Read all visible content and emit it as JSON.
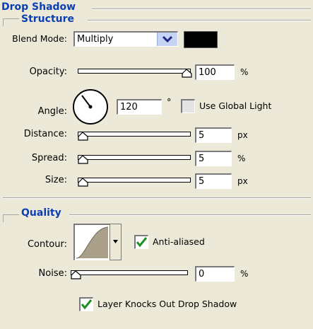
{
  "panel": {
    "title": "Drop Shadow"
  },
  "structure": {
    "title": "Structure",
    "blend_mode": {
      "label": "Blend Mode:",
      "value": "Multiply",
      "color": "#000000"
    },
    "opacity": {
      "label": "Opacity:",
      "value": "100",
      "unit": "%",
      "level": 1.0
    },
    "angle": {
      "label": "Angle:",
      "value": "120",
      "unit": "°",
      "use_global_light_label": "Use Global Light",
      "use_global_light_checked": false
    },
    "distance": {
      "label": "Distance:",
      "value": "5",
      "unit": "px",
      "level": 0.0
    },
    "spread": {
      "label": "Spread:",
      "value": "5",
      "unit": "%",
      "level": 0.0
    },
    "size": {
      "label": "Size:",
      "value": "5",
      "unit": "px",
      "level": 0.0
    }
  },
  "quality": {
    "title": "Quality",
    "contour": {
      "label": "Contour:"
    },
    "anti_aliased": {
      "label": "Anti-aliased",
      "checked": true
    },
    "noise": {
      "label": "Noise:",
      "value": "0",
      "unit": "%",
      "level": 0.0
    }
  },
  "layer_knocks_out": {
    "label": "Layer Knocks Out Drop Shadow",
    "checked": true
  },
  "colors": {
    "accent": "#0b3fb5",
    "check": "#1f8f1f",
    "select_button": "#c7d3f2"
  }
}
